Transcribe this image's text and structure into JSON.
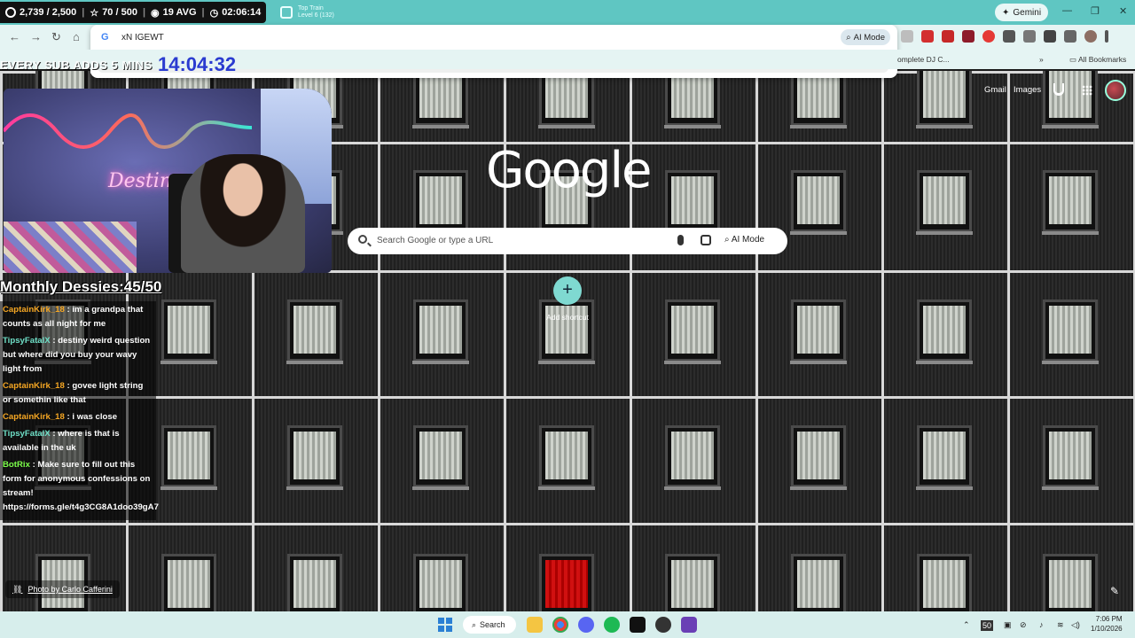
{
  "stream_stats": {
    "followers": "2,739 / 2,500",
    "stars": "70 / 500",
    "avg": "19 AVG",
    "time": "02:06:14"
  },
  "tab": {
    "title_line1": "Top Train",
    "title_line2": "Level 6 (132)"
  },
  "titlebar": {
    "gemini_label": "Gemini"
  },
  "omnibox": {
    "typed": "xN IGEWT",
    "ai_mode_label": "AI Mode",
    "suggestion_text": "xN IGEWT"
  },
  "bookmarks": {
    "partial_item": "omplete DJ C...",
    "all_bookmarks": "All Bookmarks"
  },
  "overlay": {
    "sub_banner": "EVERY SUB ADDS 5 MINS",
    "timer": "14:04:32",
    "webcam_neon_sign": "Destiny",
    "monthly_goal": "Monthly Dessies:45/50"
  },
  "chat": [
    {
      "user": "CaptainKirk_18",
      "color": "#f5a623",
      "text": "im a grandpa that counts as all night for me"
    },
    {
      "user": "TipsyFatalX",
      "color": "#6fe0c8",
      "text": "destiny weird question but where did you buy your wavy light from"
    },
    {
      "user": "CaptainKirk_18",
      "color": "#f5a623",
      "text": "govee light string or somethin like that"
    },
    {
      "user": "CaptainKirk_18",
      "color": "#f5a623",
      "text": "i was close"
    },
    {
      "user": "TipsyFatalX",
      "color": "#6fe0c8",
      "text": "where is that is available in the uk"
    },
    {
      "user": "BotRix",
      "color": "#7cff4a",
      "text": "Make sure to fill out this form for anonymous confessions on stream! https://forms.gle/t4g3CG8A1doo39gA7"
    }
  ],
  "google": {
    "logo": "Google",
    "gmail": "Gmail",
    "images": "Images",
    "search_placeholder": "Search Google or type a URL",
    "ai_mode": "AI Mode",
    "add_shortcut": "Add shortcut",
    "photo_credit": "Photo by Carlo Cafferini"
  },
  "taskbar": {
    "search_label": "Search",
    "time": "7:06 PM",
    "date": "1/10/2026",
    "tray_badge": "50"
  }
}
